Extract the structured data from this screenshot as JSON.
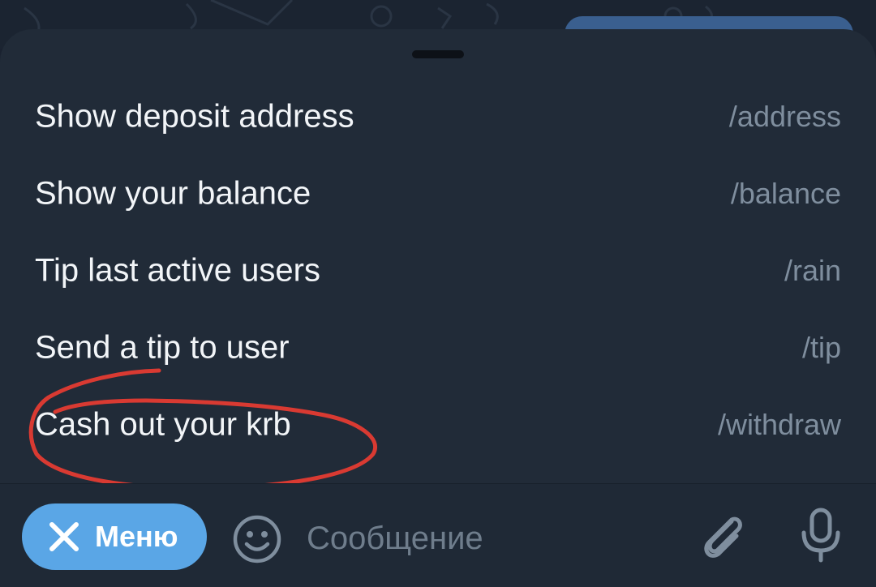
{
  "commands": [
    {
      "description": "Show deposit address",
      "command": "/address"
    },
    {
      "description": "Show your balance",
      "command": "/balance"
    },
    {
      "description": "Tip last active users",
      "command": "/rain"
    },
    {
      "description": "Send a tip to user",
      "command": "/tip"
    },
    {
      "description": "Cash out your krb",
      "command": "/withdraw"
    }
  ],
  "input_bar": {
    "menu_label": "Меню",
    "message_placeholder": "Сообщение",
    "menu_icon": "close-icon",
    "emoji_icon": "emoji-icon",
    "attach_icon": "paperclip-icon",
    "voice_icon": "microphone-icon"
  },
  "colors": {
    "sheet_bg": "#212b38",
    "menu_button": "#5aa6e6",
    "annotation": "#d93a32",
    "command_text": "#7f8e9e"
  }
}
